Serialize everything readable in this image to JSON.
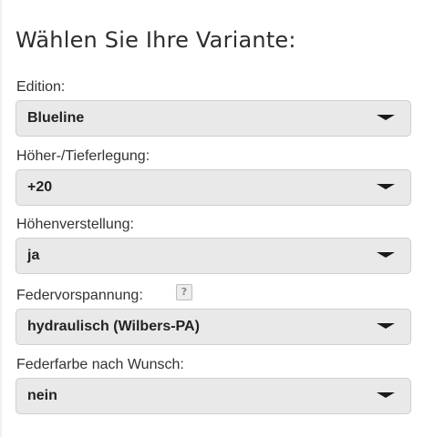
{
  "heading": "Wählen Sie Ihre Variante:",
  "fields": [
    {
      "label": "Edition:",
      "value": "Blueline"
    },
    {
      "label": "Höher-/Tieferlegung:",
      "value": "+20"
    },
    {
      "label": "Höhenverstellung:",
      "value": "ja"
    },
    {
      "label": "Federvorspannung:",
      "value": "hydraulisch (Wilbers-PA)",
      "help": "?"
    },
    {
      "label": "Federfarbe nach Wunsch:",
      "value": "nein"
    }
  ],
  "icons": {
    "dropdown": "chevron-down-icon",
    "help": "help-icon"
  }
}
